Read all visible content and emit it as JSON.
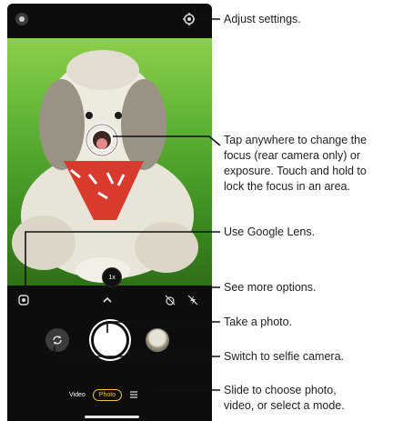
{
  "camera": {
    "zoom_label": "1x",
    "modes": {
      "video": "Video",
      "photo": "Photo"
    },
    "accent_color": "#f4c542"
  },
  "callouts": {
    "adjust_settings": "Adjust settings.",
    "tap_focus": [
      "Tap anywhere to change the",
      "focus (rear camera only) or",
      "exposure. Touch and hold to",
      "lock the focus in an area."
    ],
    "google_lens": "Use Google Lens.",
    "more_options": "See more options.",
    "take_photo": "Take a photo.",
    "switch_selfie": "Switch to selfie camera.",
    "slide_mode": [
      "Slide to choose photo,",
      "video, or select a mode."
    ]
  },
  "icons": [
    "gear-icon",
    "google-lens-icon",
    "chevron-up-icon",
    "timer-off-icon",
    "flash-off-icon",
    "switch-camera-icon",
    "menu-icon",
    "effects-icon"
  ]
}
